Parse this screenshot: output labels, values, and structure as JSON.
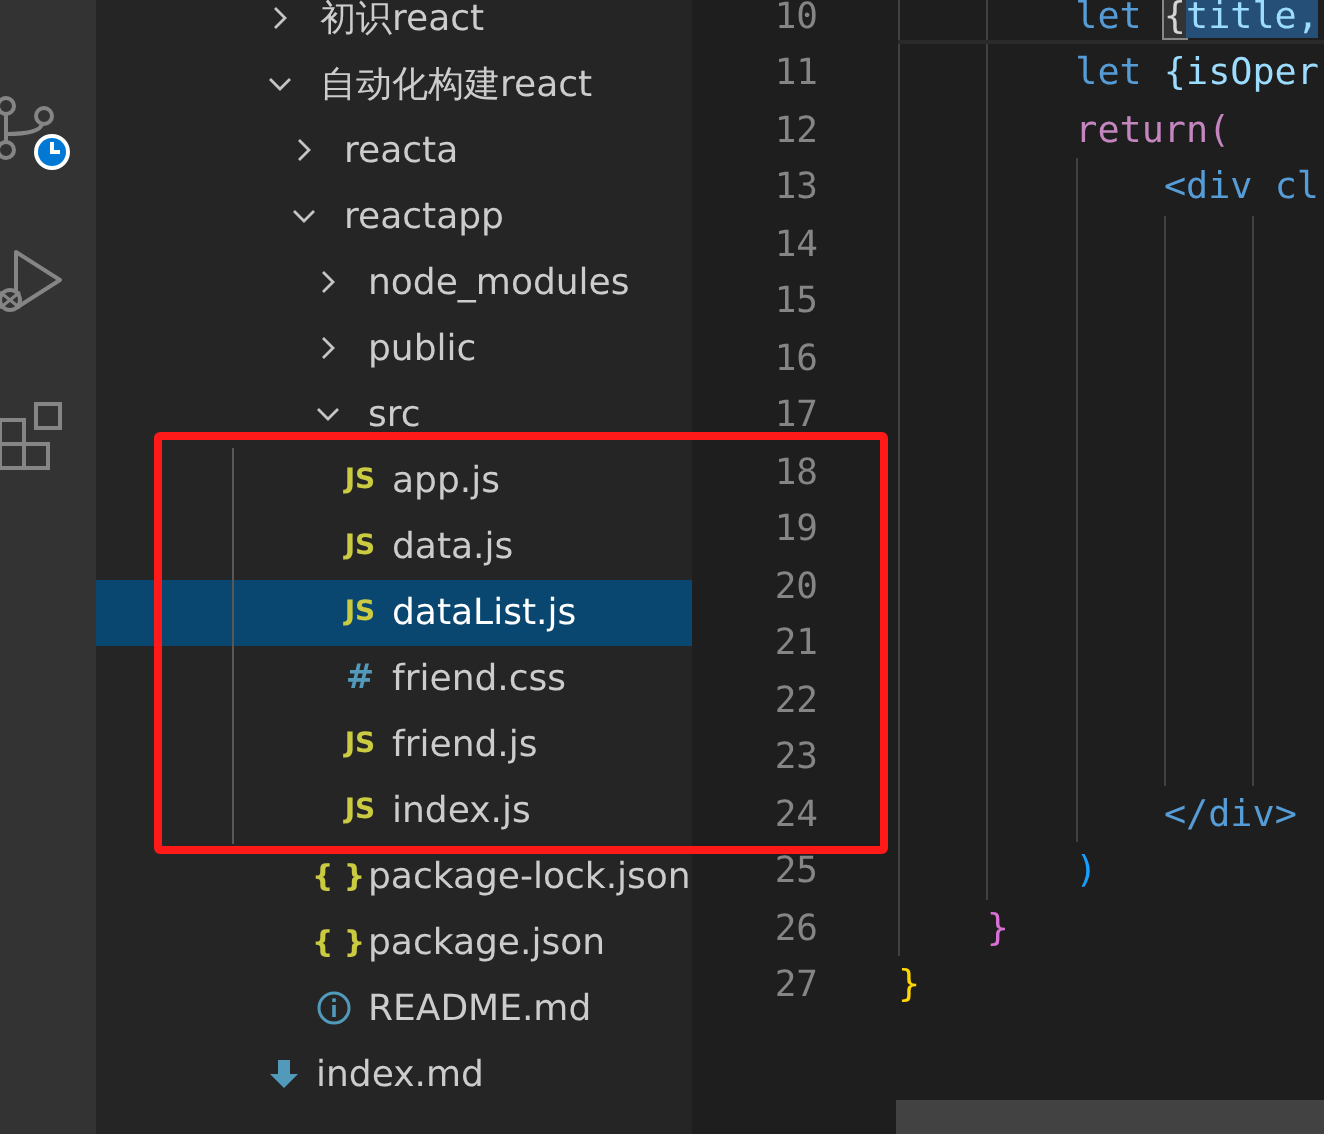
{
  "tree": [
    {
      "label": "初识react",
      "kind": "folder",
      "expanded": false,
      "selected": false
    },
    {
      "label": "自动化构建react",
      "kind": "folder",
      "expanded": true,
      "selected": false,
      "children": [
        {
          "label": "reacta",
          "kind": "folder",
          "expanded": false,
          "selected": false
        },
        {
          "label": "reactapp",
          "kind": "folder",
          "expanded": true,
          "selected": false,
          "children": [
            {
              "label": "node_modules",
              "kind": "folder",
              "expanded": false,
              "selected": false
            },
            {
              "label": "public",
              "kind": "folder",
              "expanded": false,
              "selected": false
            },
            {
              "label": "src",
              "kind": "folder",
              "expanded": true,
              "selected": false,
              "children": [
                {
                  "label": "app.js",
                  "kind": "js",
                  "glyph": "JS",
                  "selected": false
                },
                {
                  "label": "data.js",
                  "kind": "js",
                  "glyph": "JS",
                  "selected": false
                },
                {
                  "label": "dataList.js",
                  "kind": "js",
                  "glyph": "JS",
                  "selected": true
                },
                {
                  "label": "friend.css",
                  "kind": "css",
                  "glyph": "#",
                  "selected": false
                },
                {
                  "label": "friend.js",
                  "kind": "js",
                  "glyph": "JS",
                  "selected": false
                },
                {
                  "label": "index.js",
                  "kind": "js",
                  "glyph": "JS",
                  "selected": false
                }
              ]
            },
            {
              "label": "package-lock.json",
              "kind": "json",
              "glyph": "{ }",
              "selected": false
            },
            {
              "label": "package.json",
              "kind": "json",
              "glyph": "{ }",
              "selected": false
            },
            {
              "label": "README.md",
              "kind": "info",
              "selected": false
            }
          ]
        }
      ]
    },
    {
      "label": "index.md",
      "kind": "markdown",
      "selected": false
    }
  ],
  "editor": {
    "lines": [
      {
        "number": "10",
        "current": true,
        "tokens": [
          {
            "text": "let",
            "kind": "keyword"
          },
          {
            "text": "{",
            "kind": "matched-bracket"
          },
          {
            "text": "title,",
            "kind": "selected"
          }
        ]
      },
      {
        "number": "11",
        "current": false,
        "tokens": [
          {
            "text": "let",
            "kind": "keyword"
          },
          {
            "text": "{isOper",
            "kind": "variable"
          }
        ]
      },
      {
        "number": "12",
        "current": false,
        "tokens": [
          {
            "text": "return(",
            "kind": "control"
          }
        ]
      },
      {
        "number": "13",
        "current": false,
        "tokens": [
          {
            "text": "<div cl",
            "kind": "tag"
          }
        ]
      },
      {
        "number": "14",
        "current": false
      },
      {
        "number": "15",
        "current": false
      },
      {
        "number": "16",
        "current": false
      },
      {
        "number": "17",
        "current": false
      },
      {
        "number": "18",
        "current": false
      },
      {
        "number": "19",
        "current": false
      },
      {
        "number": "20",
        "current": false
      },
      {
        "number": "21",
        "current": false
      },
      {
        "number": "22",
        "current": false
      },
      {
        "number": "23",
        "current": false
      },
      {
        "number": "24",
        "current": false,
        "tokens": [
          {
            "text": "</div>",
            "kind": "tag"
          }
        ]
      },
      {
        "number": "25",
        "current": false,
        "tokens": [
          {
            "text": ")",
            "kind": "bracket-blue"
          }
        ]
      },
      {
        "number": "26",
        "current": false,
        "tokens": [
          {
            "text": "}",
            "kind": "bracket-pink"
          }
        ]
      },
      {
        "number": "27",
        "current": false,
        "tokens": [
          {
            "text": "}",
            "kind": "bracket-gold"
          }
        ]
      }
    ]
  }
}
